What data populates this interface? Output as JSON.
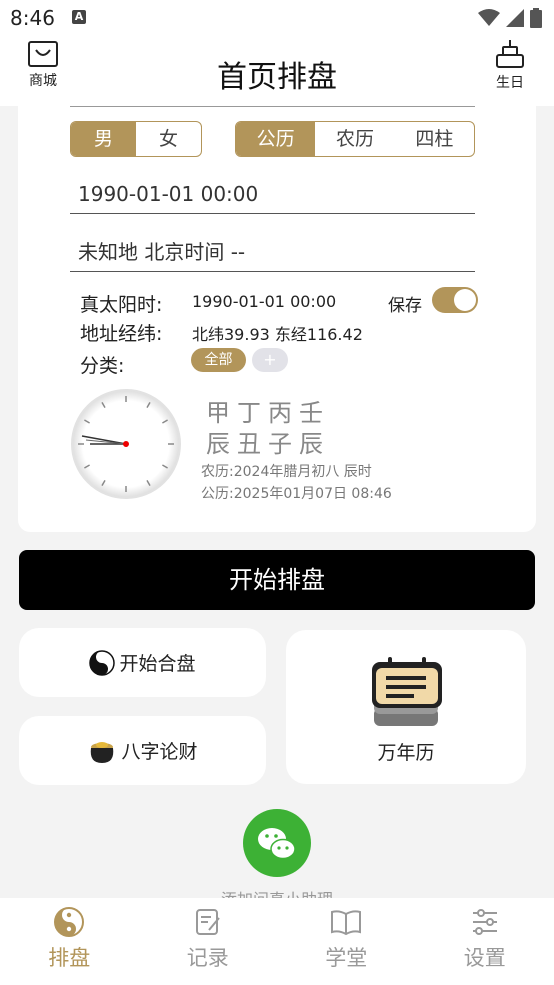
{
  "status": {
    "time": "8:46",
    "a_icon": "A"
  },
  "header": {
    "title": "首页排盘",
    "left_label": "商城",
    "right_label": "生日"
  },
  "gender": {
    "options": [
      "男",
      "女"
    ],
    "selected": "男"
  },
  "calendar_type": {
    "options": [
      "公历",
      "农历",
      "四柱"
    ],
    "selected": "公历"
  },
  "datetime_value": "1990-01-01 00:00",
  "location_value": "未知地 北京时间 --",
  "info": {
    "solar_time_label": "真太阳时:",
    "solar_time_value": "1990-01-01 00:00",
    "coords_label": "地址经纬:",
    "coords_value": "北纬39.93 东经116.42",
    "category_label": "分类:",
    "save_label": "保存",
    "save_enabled": true
  },
  "category": {
    "all_label": "全部",
    "add_label": "+"
  },
  "bazi": {
    "stems": "甲丁丙壬",
    "branches": "辰丑子辰",
    "lunar": "农历:2024年腊月初八 辰时",
    "solar": "公历:2025年01月07日 08:46"
  },
  "start_button": "开始排盘",
  "tiles": {
    "hepan": "开始合盘",
    "caifu": "八字论财",
    "wannianli": "万年历"
  },
  "wechat_label": "添加问真小助理",
  "nav": [
    {
      "label": "排盘",
      "icon": "yinyang-icon",
      "active": true
    },
    {
      "label": "记录",
      "icon": "edit-icon",
      "active": false
    },
    {
      "label": "学堂",
      "icon": "book-icon",
      "active": false
    },
    {
      "label": "设置",
      "icon": "sliders-icon",
      "active": false
    }
  ],
  "colors": {
    "accent": "#b2955a",
    "wechat": "#3db135",
    "background": "#f3f3f3"
  }
}
